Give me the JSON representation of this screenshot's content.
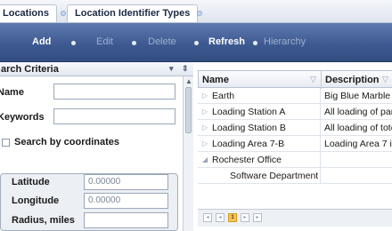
{
  "tabs": [
    {
      "label": "Locations"
    },
    {
      "label": "Location Identifier Types"
    }
  ],
  "toolbar": {
    "add": "Add",
    "edit": "Edit",
    "delete": "Delete",
    "refresh": "Refresh",
    "hierarchy": "Hierarchy"
  },
  "search": {
    "header": "arch Criteria",
    "name_label": "Name",
    "name_value": "",
    "keywords_label": "Keywords",
    "keywords_value": "",
    "by_coords_label": "Search by coordinates",
    "by_coords_checked": false,
    "latitude_label": "Latitude",
    "latitude_value": "0.00000",
    "longitude_label": "Longitude",
    "longitude_value": "0.00000",
    "radius_label": "Radius, miles",
    "radius_value": ""
  },
  "grid": {
    "columns": [
      "Name",
      "Description"
    ],
    "rows": [
      {
        "name": "Earth",
        "description": "Big Blue Marble",
        "expander": "collapsed"
      },
      {
        "name": "Loading Station A",
        "description": "All loading of par",
        "expander": "collapsed"
      },
      {
        "name": "Loading Station B",
        "description": "All loading of tote",
        "expander": "collapsed"
      },
      {
        "name": "Loading Area 7-B",
        "description": "Loading Area 7 in",
        "expander": "collapsed"
      },
      {
        "name": "Rochester Office",
        "description": "",
        "expander": "expanded"
      },
      {
        "name": "Software Department",
        "description": "",
        "expander": "none"
      }
    ],
    "pager": {
      "current_page": "1"
    }
  },
  "colors": {
    "toolbar": "#3e5a91",
    "accent_page": "#f4c35a",
    "panel_border": "#a9b6c9"
  },
  "icons": {
    "filter": "filter-icon",
    "collapse": "chevron-down-icon",
    "pin": "pin-icon",
    "expand_collapsed": "caret-right-icon",
    "expand_expanded": "caret-down-icon"
  }
}
